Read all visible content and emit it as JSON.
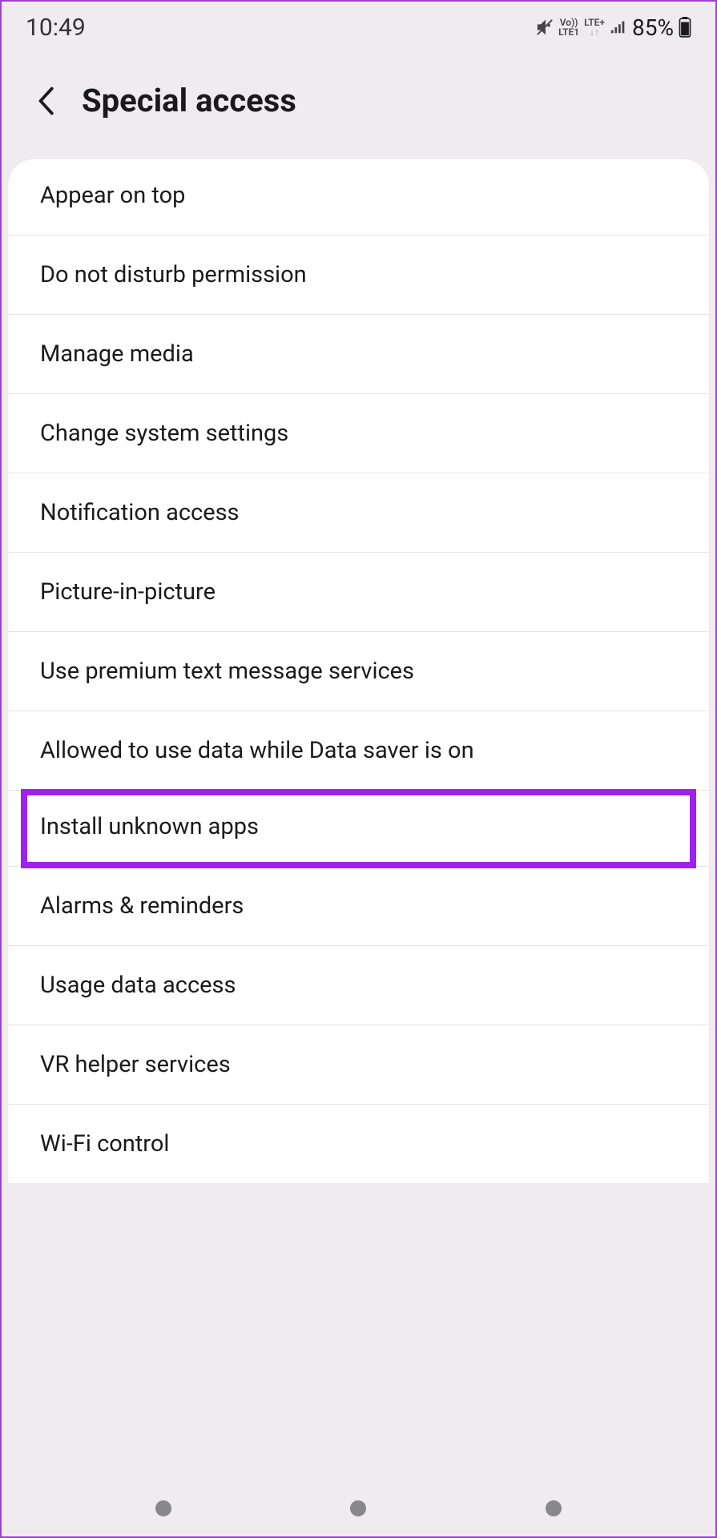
{
  "status": {
    "time": "10:49",
    "battery": "85%",
    "volte_top": "Vo))",
    "volte_bottom": "LTE1",
    "lte_top": "LTE+",
    "lte_arrows": "↓↑"
  },
  "header": {
    "title": "Special access"
  },
  "items": [
    {
      "label": "Appear on top",
      "highlighted": false
    },
    {
      "label": "Do not disturb permission",
      "highlighted": false
    },
    {
      "label": "Manage media",
      "highlighted": false
    },
    {
      "label": "Change system settings",
      "highlighted": false
    },
    {
      "label": "Notification access",
      "highlighted": false
    },
    {
      "label": "Picture-in-picture",
      "highlighted": false
    },
    {
      "label": "Use premium text message services",
      "highlighted": false
    },
    {
      "label": "Allowed to use data while Data saver is on",
      "highlighted": false
    },
    {
      "label": "Install unknown apps",
      "highlighted": true
    },
    {
      "label": "Alarms & reminders",
      "highlighted": false
    },
    {
      "label": "Usage data access",
      "highlighted": false
    },
    {
      "label": "VR helper services",
      "highlighted": false
    },
    {
      "label": "Wi-Fi control",
      "highlighted": false
    }
  ],
  "highlight_color": "#a020f0"
}
